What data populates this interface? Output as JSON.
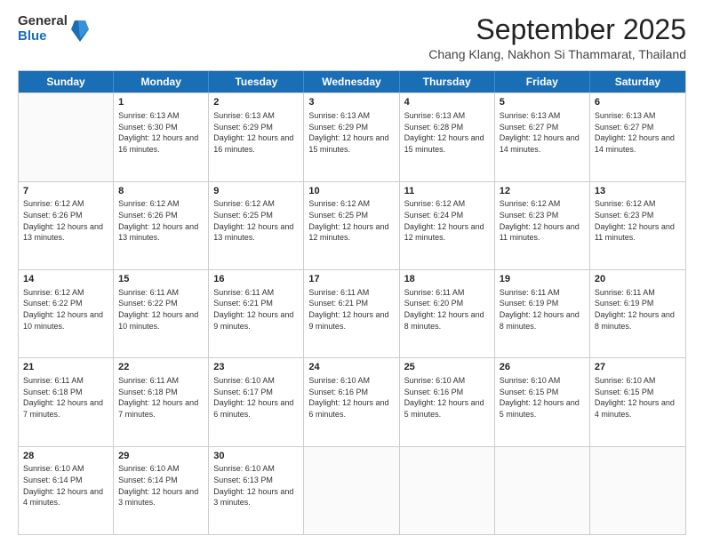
{
  "logo": {
    "general": "General",
    "blue": "Blue"
  },
  "header": {
    "title": "September 2025",
    "subtitle": "Chang Klang, Nakhon Si Thammarat, Thailand"
  },
  "weekdays": [
    "Sunday",
    "Monday",
    "Tuesday",
    "Wednesday",
    "Thursday",
    "Friday",
    "Saturday"
  ],
  "rows": [
    [
      {
        "day": "",
        "sunrise": "",
        "sunset": "",
        "daylight": ""
      },
      {
        "day": "1",
        "sunrise": "Sunrise: 6:13 AM",
        "sunset": "Sunset: 6:30 PM",
        "daylight": "Daylight: 12 hours and 16 minutes."
      },
      {
        "day": "2",
        "sunrise": "Sunrise: 6:13 AM",
        "sunset": "Sunset: 6:29 PM",
        "daylight": "Daylight: 12 hours and 16 minutes."
      },
      {
        "day": "3",
        "sunrise": "Sunrise: 6:13 AM",
        "sunset": "Sunset: 6:29 PM",
        "daylight": "Daylight: 12 hours and 15 minutes."
      },
      {
        "day": "4",
        "sunrise": "Sunrise: 6:13 AM",
        "sunset": "Sunset: 6:28 PM",
        "daylight": "Daylight: 12 hours and 15 minutes."
      },
      {
        "day": "5",
        "sunrise": "Sunrise: 6:13 AM",
        "sunset": "Sunset: 6:27 PM",
        "daylight": "Daylight: 12 hours and 14 minutes."
      },
      {
        "day": "6",
        "sunrise": "Sunrise: 6:13 AM",
        "sunset": "Sunset: 6:27 PM",
        "daylight": "Daylight: 12 hours and 14 minutes."
      }
    ],
    [
      {
        "day": "7",
        "sunrise": "Sunrise: 6:12 AM",
        "sunset": "Sunset: 6:26 PM",
        "daylight": "Daylight: 12 hours and 13 minutes."
      },
      {
        "day": "8",
        "sunrise": "Sunrise: 6:12 AM",
        "sunset": "Sunset: 6:26 PM",
        "daylight": "Daylight: 12 hours and 13 minutes."
      },
      {
        "day": "9",
        "sunrise": "Sunrise: 6:12 AM",
        "sunset": "Sunset: 6:25 PM",
        "daylight": "Daylight: 12 hours and 13 minutes."
      },
      {
        "day": "10",
        "sunrise": "Sunrise: 6:12 AM",
        "sunset": "Sunset: 6:25 PM",
        "daylight": "Daylight: 12 hours and 12 minutes."
      },
      {
        "day": "11",
        "sunrise": "Sunrise: 6:12 AM",
        "sunset": "Sunset: 6:24 PM",
        "daylight": "Daylight: 12 hours and 12 minutes."
      },
      {
        "day": "12",
        "sunrise": "Sunrise: 6:12 AM",
        "sunset": "Sunset: 6:23 PM",
        "daylight": "Daylight: 12 hours and 11 minutes."
      },
      {
        "day": "13",
        "sunrise": "Sunrise: 6:12 AM",
        "sunset": "Sunset: 6:23 PM",
        "daylight": "Daylight: 12 hours and 11 minutes."
      }
    ],
    [
      {
        "day": "14",
        "sunrise": "Sunrise: 6:12 AM",
        "sunset": "Sunset: 6:22 PM",
        "daylight": "Daylight: 12 hours and 10 minutes."
      },
      {
        "day": "15",
        "sunrise": "Sunrise: 6:11 AM",
        "sunset": "Sunset: 6:22 PM",
        "daylight": "Daylight: 12 hours and 10 minutes."
      },
      {
        "day": "16",
        "sunrise": "Sunrise: 6:11 AM",
        "sunset": "Sunset: 6:21 PM",
        "daylight": "Daylight: 12 hours and 9 minutes."
      },
      {
        "day": "17",
        "sunrise": "Sunrise: 6:11 AM",
        "sunset": "Sunset: 6:21 PM",
        "daylight": "Daylight: 12 hours and 9 minutes."
      },
      {
        "day": "18",
        "sunrise": "Sunrise: 6:11 AM",
        "sunset": "Sunset: 6:20 PM",
        "daylight": "Daylight: 12 hours and 8 minutes."
      },
      {
        "day": "19",
        "sunrise": "Sunrise: 6:11 AM",
        "sunset": "Sunset: 6:19 PM",
        "daylight": "Daylight: 12 hours and 8 minutes."
      },
      {
        "day": "20",
        "sunrise": "Sunrise: 6:11 AM",
        "sunset": "Sunset: 6:19 PM",
        "daylight": "Daylight: 12 hours and 8 minutes."
      }
    ],
    [
      {
        "day": "21",
        "sunrise": "Sunrise: 6:11 AM",
        "sunset": "Sunset: 6:18 PM",
        "daylight": "Daylight: 12 hours and 7 minutes."
      },
      {
        "day": "22",
        "sunrise": "Sunrise: 6:11 AM",
        "sunset": "Sunset: 6:18 PM",
        "daylight": "Daylight: 12 hours and 7 minutes."
      },
      {
        "day": "23",
        "sunrise": "Sunrise: 6:10 AM",
        "sunset": "Sunset: 6:17 PM",
        "daylight": "Daylight: 12 hours and 6 minutes."
      },
      {
        "day": "24",
        "sunrise": "Sunrise: 6:10 AM",
        "sunset": "Sunset: 6:16 PM",
        "daylight": "Daylight: 12 hours and 6 minutes."
      },
      {
        "day": "25",
        "sunrise": "Sunrise: 6:10 AM",
        "sunset": "Sunset: 6:16 PM",
        "daylight": "Daylight: 12 hours and 5 minutes."
      },
      {
        "day": "26",
        "sunrise": "Sunrise: 6:10 AM",
        "sunset": "Sunset: 6:15 PM",
        "daylight": "Daylight: 12 hours and 5 minutes."
      },
      {
        "day": "27",
        "sunrise": "Sunrise: 6:10 AM",
        "sunset": "Sunset: 6:15 PM",
        "daylight": "Daylight: 12 hours and 4 minutes."
      }
    ],
    [
      {
        "day": "28",
        "sunrise": "Sunrise: 6:10 AM",
        "sunset": "Sunset: 6:14 PM",
        "daylight": "Daylight: 12 hours and 4 minutes."
      },
      {
        "day": "29",
        "sunrise": "Sunrise: 6:10 AM",
        "sunset": "Sunset: 6:14 PM",
        "daylight": "Daylight: 12 hours and 3 minutes."
      },
      {
        "day": "30",
        "sunrise": "Sunrise: 6:10 AM",
        "sunset": "Sunset: 6:13 PM",
        "daylight": "Daylight: 12 hours and 3 minutes."
      },
      {
        "day": "",
        "sunrise": "",
        "sunset": "",
        "daylight": ""
      },
      {
        "day": "",
        "sunrise": "",
        "sunset": "",
        "daylight": ""
      },
      {
        "day": "",
        "sunrise": "",
        "sunset": "",
        "daylight": ""
      },
      {
        "day": "",
        "sunrise": "",
        "sunset": "",
        "daylight": ""
      }
    ]
  ]
}
